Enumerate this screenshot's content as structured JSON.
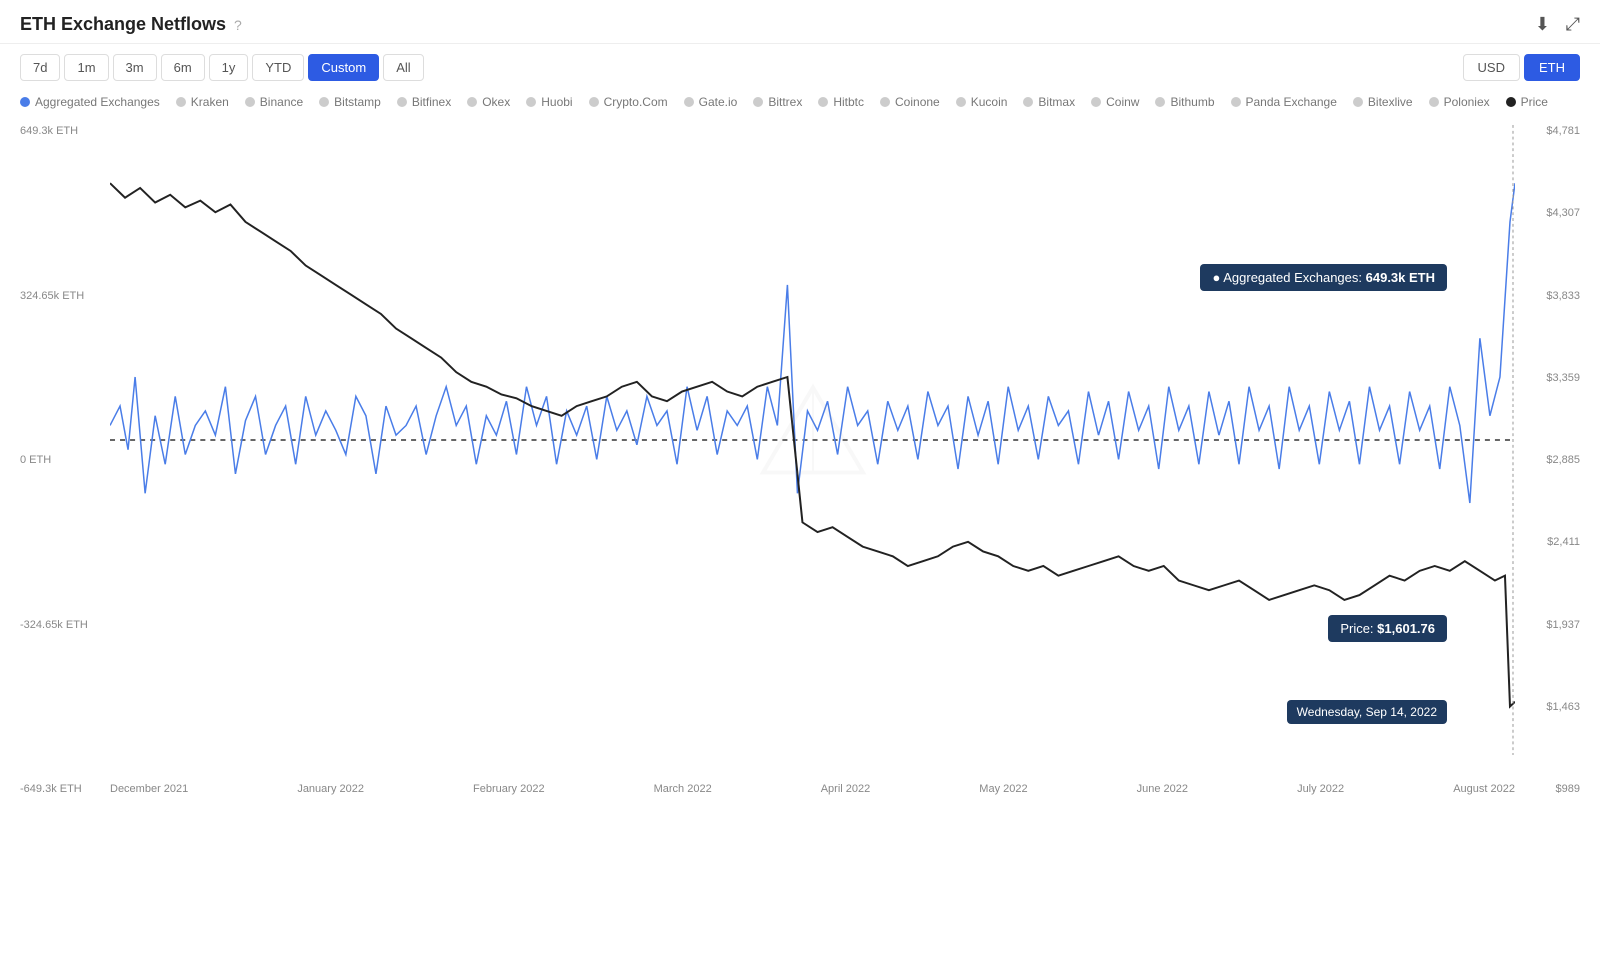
{
  "header": {
    "title": "ETH Exchange Netflows",
    "help_label": "?"
  },
  "toolbar": {
    "time_buttons": [
      {
        "label": "7d",
        "active": false
      },
      {
        "label": "1m",
        "active": false
      },
      {
        "label": "3m",
        "active": false
      },
      {
        "label": "6m",
        "active": false
      },
      {
        "label": "1y",
        "active": false
      },
      {
        "label": "YTD",
        "active": false
      },
      {
        "label": "Custom",
        "active": true
      },
      {
        "label": "All",
        "active": false
      }
    ],
    "currency_buttons": [
      {
        "label": "USD",
        "active": false
      },
      {
        "label": "ETH",
        "active": true
      }
    ]
  },
  "legend": {
    "items": [
      {
        "label": "Aggregated Exchanges",
        "color": "#4a7de8",
        "active": true
      },
      {
        "label": "Kraken",
        "color": "#aaa"
      },
      {
        "label": "Binance",
        "color": "#aaa"
      },
      {
        "label": "Bitstamp",
        "color": "#aaa"
      },
      {
        "label": "Bitfinex",
        "color": "#aaa"
      },
      {
        "label": "Okex",
        "color": "#aaa"
      },
      {
        "label": "Huobi",
        "color": "#aaa"
      },
      {
        "label": "Crypto.Com",
        "color": "#aaa"
      },
      {
        "label": "Gate.io",
        "color": "#aaa"
      },
      {
        "label": "Bittrex",
        "color": "#aaa"
      },
      {
        "label": "Hitbtc",
        "color": "#aaa"
      },
      {
        "label": "Coinone",
        "color": "#aaa"
      },
      {
        "label": "Kucoin",
        "color": "#aaa"
      },
      {
        "label": "Bitmax",
        "color": "#aaa"
      },
      {
        "label": "Coinw",
        "color": "#aaa"
      },
      {
        "label": "Bithumb",
        "color": "#aaa"
      },
      {
        "label": "Panda Exchange",
        "color": "#aaa"
      },
      {
        "label": "Bitexlive",
        "color": "#aaa"
      },
      {
        "label": "Poloniex",
        "color": "#aaa"
      },
      {
        "label": "Price",
        "color": "#222"
      }
    ]
  },
  "chart": {
    "y_axis_left": [
      "649.3k ETH",
      "324.65k ETH",
      "0 ETH",
      "-324.65k ETH",
      "-649.3k ETH"
    ],
    "y_axis_right": [
      "$4,781",
      "$4,307",
      "$3,833",
      "$3,359",
      "$2,885",
      "$2,411",
      "$1,937",
      "$1,463",
      "$989"
    ],
    "x_axis": [
      "December 2021",
      "January 2022",
      "February 2022",
      "March 2022",
      "April 2022",
      "May 2022",
      "June 2022",
      "July 2022",
      "August 2022"
    ],
    "tooltips": {
      "aggregated": "Aggregated Exchanges: 649.3k ETH",
      "price": "Price: $1,601.76",
      "date": "Wednesday, Sep 14, 2022"
    }
  },
  "icons": {
    "download": "⬇",
    "expand": "⤢"
  }
}
